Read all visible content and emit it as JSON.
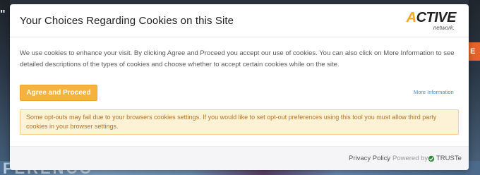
{
  "background": {
    "left_char": "\"",
    "right_tab": "E",
    "bottom_text": "FERENCO"
  },
  "modal": {
    "title": "Your Choices Regarding Cookies on this Site",
    "logo": {
      "prefix": "A",
      "word": "CTIVE",
      "sub": "network."
    },
    "intro": "We use cookies to enhance your visit. By clicking Agree and Proceed you accept our use of cookies. You can also click on More Information to see detailed descriptions of the types of cookies and choose whether to accept certain cookies while on the site.",
    "agree_button": "Agree and Proceed",
    "more_info_link": "More Information",
    "notice": "Some opt-outs may fail due to your browsers cookies settings. If you would like to set opt-out preferences using this tool you must allow third party cookies in your browser settings.",
    "footer": {
      "privacy": "Privacy Policy",
      "separator": "|",
      "powered_by": "Powered by",
      "truste": "TRUSTe"
    }
  },
  "colors": {
    "accent": "#f6b23e",
    "link": "#4a90c8",
    "notice_bg": "#fdf1d6",
    "notice_text": "#b1772a"
  }
}
